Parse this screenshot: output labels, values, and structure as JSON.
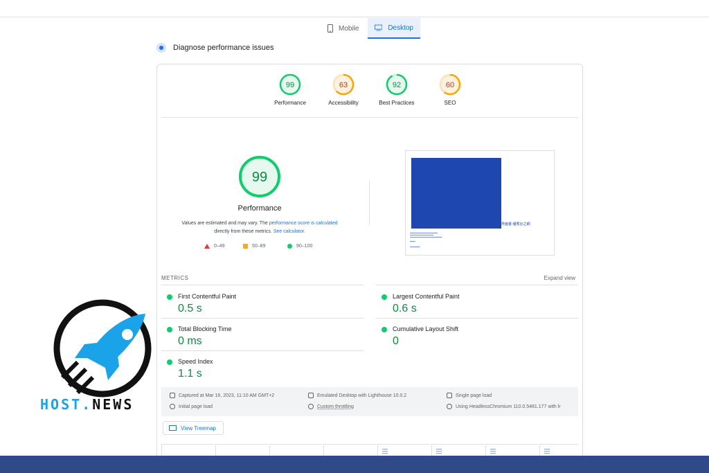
{
  "device_tabs": {
    "mobile": "Mobile",
    "desktop": "Desktop",
    "active": "Desktop"
  },
  "diagnose_title": "Diagnose performance issues",
  "categories": [
    {
      "score": "99",
      "label": "Performance",
      "color": "#0cce6b"
    },
    {
      "score": "63",
      "label": "Accessibility",
      "color": "#ffa400"
    },
    {
      "score": "92",
      "label": "Best Practices",
      "color": "#0cce6b"
    },
    {
      "score": "60",
      "label": "SEO",
      "color": "#ffa400"
    }
  ],
  "main_score": {
    "score": "99",
    "title": "Performance"
  },
  "note": {
    "pre": "Values are estimated and may vary. The ",
    "link1": "performance score is calculated",
    "mid": " directly from these metrics. ",
    "link2": "See calculator."
  },
  "legend": {
    "low": "0–49",
    "mid": "50–89",
    "high": "90–100"
  },
  "screenshot": {
    "link_text": "界面書-優秀比之網"
  },
  "metrics_header": "METRICS",
  "expand_view": "Expand view",
  "metrics": [
    {
      "name": "First Contentful Paint",
      "value": "0.5 s"
    },
    {
      "name": "Largest Contentful Paint",
      "value": "0.6 s"
    },
    {
      "name": "Total Blocking Time",
      "value": "0 ms"
    },
    {
      "name": "Cumulative Layout Shift",
      "value": "0"
    },
    {
      "name": "Speed Index",
      "value": "1.1 s"
    }
  ],
  "info": {
    "captured": "Captured at Mar 16, 2023, 11:10 AM GMT+2",
    "emulated": "Emulated Desktop with Lighthouse 10.0.2",
    "single": "Single page load",
    "initial": "Initial page load",
    "throttling": "Custom throttling",
    "browser": "Using HeadlessChromium 110.0.5481.177 with lr"
  },
  "treemap_label": "View Treemap",
  "logo": {
    "part1": "HOST.",
    "part2": "NEWS"
  },
  "colors": {
    "accent": "#1a73e8",
    "pass": "#0cce6b",
    "average": "#ffa400",
    "fail": "#e53935",
    "footer": "#2f4a86"
  }
}
